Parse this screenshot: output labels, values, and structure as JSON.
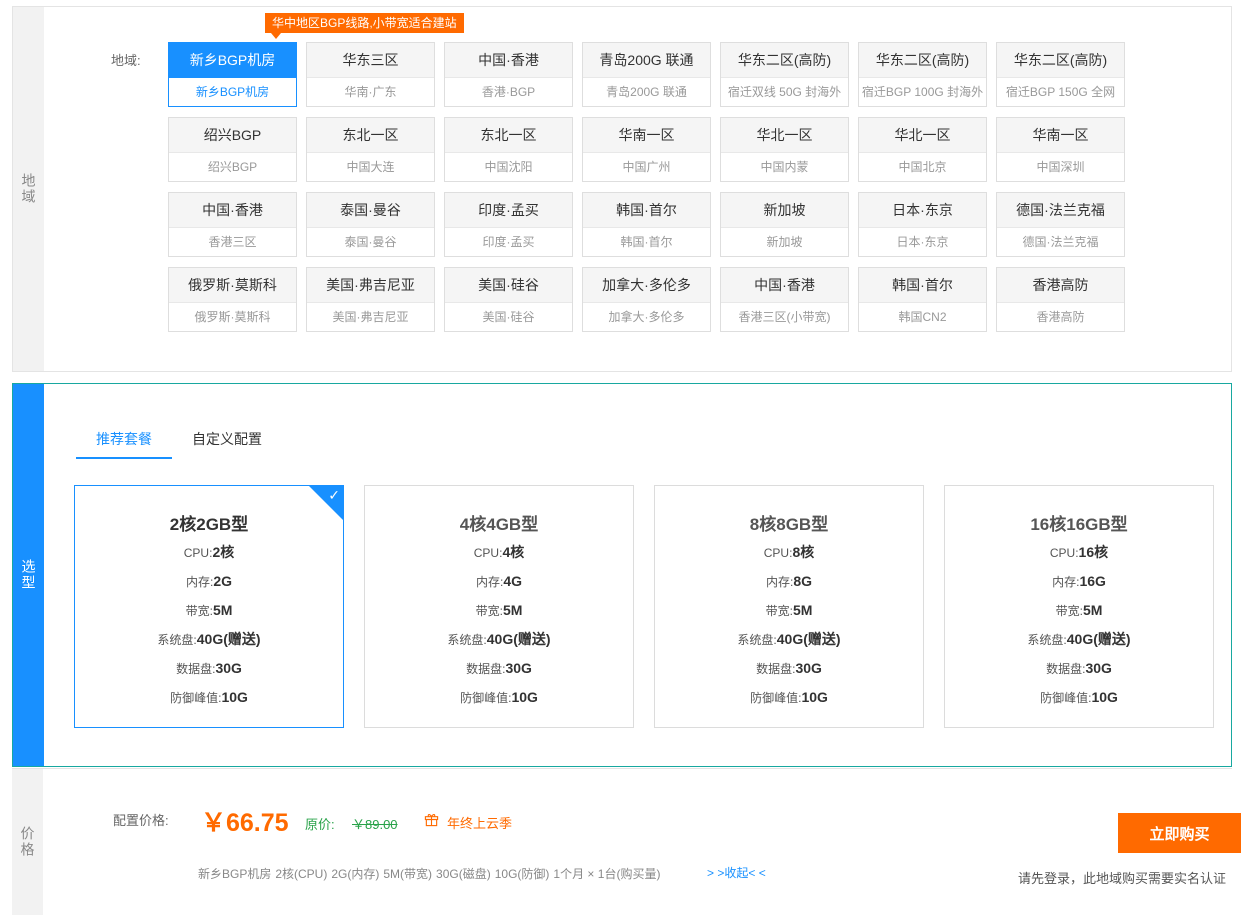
{
  "region": {
    "side_label": "地域",
    "label": "地域:",
    "promo_tag": "华中地区BGP线路,小带宽适合建站",
    "items": [
      {
        "name": "新乡BGP机房",
        "sub": "新乡BGP机房",
        "active": true
      },
      {
        "name": "华东三区",
        "sub": "华南·广东"
      },
      {
        "name": "中国·香港",
        "sub": "香港·BGP"
      },
      {
        "name": "青岛200G 联通",
        "sub": "青岛200G 联通"
      },
      {
        "name": "华东二区(高防)",
        "sub": "宿迁双线 50G 封海外"
      },
      {
        "name": "华东二区(高防)",
        "sub": "宿迁BGP 100G 封海外"
      },
      {
        "name": "华东二区(高防)",
        "sub": "宿迁BGP 150G 全网"
      },
      {
        "name": "绍兴BGP",
        "sub": "绍兴BGP"
      },
      {
        "name": "东北一区",
        "sub": "中国大连"
      },
      {
        "name": "东北一区",
        "sub": "中国沈阳"
      },
      {
        "name": "华南一区",
        "sub": "中国广州"
      },
      {
        "name": "华北一区",
        "sub": "中国内蒙"
      },
      {
        "name": "华北一区",
        "sub": "中国北京"
      },
      {
        "name": "华南一区",
        "sub": "中国深圳"
      },
      {
        "name": "中国·香港",
        "sub": "香港三区"
      },
      {
        "name": "泰国·曼谷",
        "sub": "泰国·曼谷"
      },
      {
        "name": "印度·孟买",
        "sub": "印度·孟买"
      },
      {
        "name": "韩国·首尔",
        "sub": "韩国·首尔"
      },
      {
        "name": "新加坡",
        "sub": "新加坡"
      },
      {
        "name": "日本·东京",
        "sub": "日本·东京"
      },
      {
        "name": "德国·法兰克福",
        "sub": "德国·法兰克福"
      },
      {
        "name": "俄罗斯·莫斯科",
        "sub": "俄罗斯·莫斯科"
      },
      {
        "name": "美国·弗吉尼亚",
        "sub": "美国·弗吉尼亚"
      },
      {
        "name": "美国·硅谷",
        "sub": "美国·硅谷"
      },
      {
        "name": "加拿大·多伦多",
        "sub": "加拿大·多伦多"
      },
      {
        "name": "中国·香港",
        "sub": "香港三区(小带宽)"
      },
      {
        "name": "韩国·首尔",
        "sub": "韩国CN2"
      },
      {
        "name": "香港高防",
        "sub": "香港高防"
      }
    ]
  },
  "model": {
    "side_label": "选型",
    "tabs": [
      {
        "label": "推荐套餐",
        "active": true
      },
      {
        "label": "自定义配置"
      }
    ],
    "spec_labels": {
      "cpu": "CPU:",
      "mem": "内存:",
      "bw": "带宽:",
      "sys": "系统盘:",
      "data": "数据盘:",
      "ddos": "防御峰值:"
    },
    "plans": [
      {
        "title": "2核2GB型",
        "cpu": "2核",
        "mem": "2G",
        "bw": "5M",
        "sys": "40G(赠送)",
        "data": "30G",
        "ddos": "10G",
        "selected": true
      },
      {
        "title": "4核4GB型",
        "cpu": "4核",
        "mem": "4G",
        "bw": "5M",
        "sys": "40G(赠送)",
        "data": "30G",
        "ddos": "10G"
      },
      {
        "title": "8核8GB型",
        "cpu": "8核",
        "mem": "8G",
        "bw": "5M",
        "sys": "40G(赠送)",
        "data": "30G",
        "ddos": "10G"
      },
      {
        "title": "16核16GB型",
        "cpu": "16核",
        "mem": "16G",
        "bw": "5M",
        "sys": "40G(赠送)",
        "data": "30G",
        "ddos": "10G"
      }
    ]
  },
  "price": {
    "side_label": "价格",
    "label": "配置价格:",
    "value": "￥66.75",
    "original_label": "原价:",
    "original_value": "￥89.00",
    "promo_text": "年终上云季",
    "summary": [
      "新乡BGP机房",
      "2核(CPU)",
      "2G(内存)",
      "5M(带宽)",
      "30G(磁盘)",
      "10G(防御)",
      "1个月 × 1台(购买量)"
    ],
    "collapse_link": "> >收起< <",
    "buy_button": "立即购买",
    "login_tip": "请先登录，此地域购买需要实名认证"
  },
  "colors": {
    "accent_blue": "#1890ff",
    "accent_orange": "#ff6a00",
    "original_price_green": "#2aa34a"
  }
}
